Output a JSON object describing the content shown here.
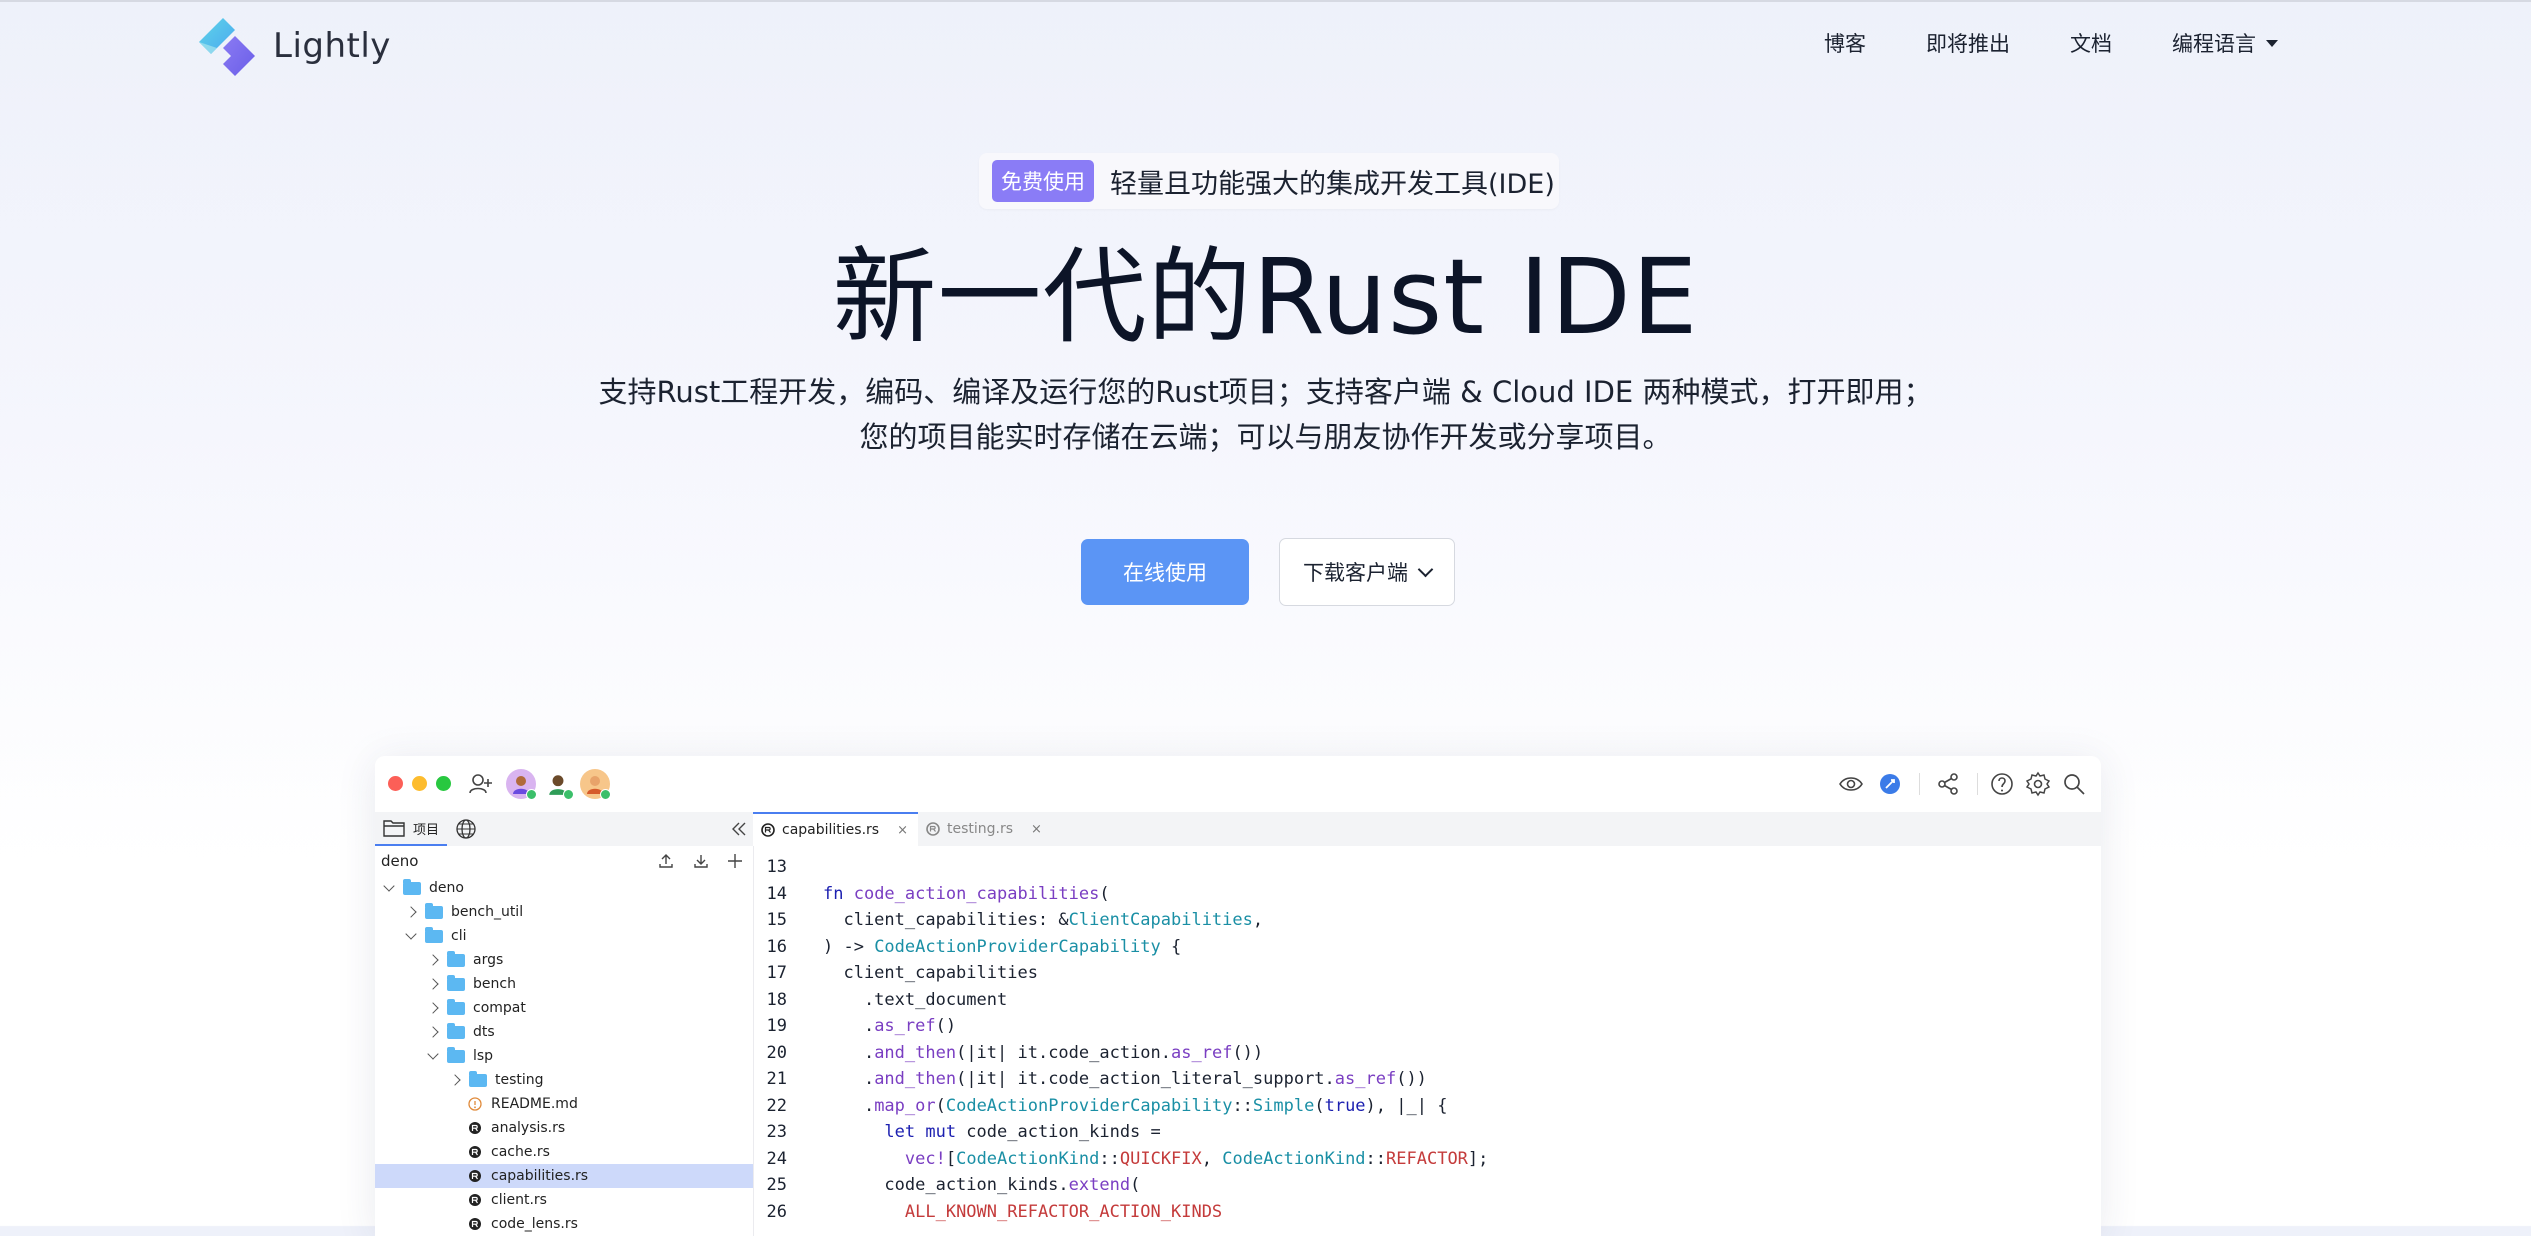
{
  "nav": {
    "brand": "Lightly",
    "items": [
      "博客",
      "即将推出",
      "文档"
    ],
    "lang_menu": "编程语言"
  },
  "hero": {
    "badge_pill": "免费使用",
    "badge_text": "轻量且功能强大的集成开发工具(IDE)",
    "title": "新一代的Rust IDE",
    "subtitle_line1": "支持Rust工程开发，编码、编译及运行您的Rust项目；支持客户端 & Cloud IDE 两种模式，打开即用；",
    "subtitle_line2": "您的项目能实时存储在云端；可以与朋友协作开发或分享项目。",
    "primary_button": "在线使用",
    "secondary_button": "下载客户端"
  },
  "ide": {
    "sidebar_tab_label": "项目",
    "project_name": "deno",
    "tree": [
      {
        "label": "deno",
        "type": "folder",
        "depth": 0,
        "expanded": true
      },
      {
        "label": "bench_util",
        "type": "folder",
        "depth": 1,
        "expanded": false
      },
      {
        "label": "cli",
        "type": "folder",
        "depth": 1,
        "expanded": true
      },
      {
        "label": "args",
        "type": "folder",
        "depth": 2,
        "expanded": false
      },
      {
        "label": "bench",
        "type": "folder",
        "depth": 2,
        "expanded": false
      },
      {
        "label": "compat",
        "type": "folder",
        "depth": 2,
        "expanded": false
      },
      {
        "label": "dts",
        "type": "folder",
        "depth": 2,
        "expanded": false
      },
      {
        "label": "lsp",
        "type": "folder",
        "depth": 2,
        "expanded": true
      },
      {
        "label": "testing",
        "type": "folder",
        "depth": 3,
        "expanded": false
      },
      {
        "label": "README.md",
        "type": "md",
        "depth": 3
      },
      {
        "label": "analysis.rs",
        "type": "rs",
        "depth": 3
      },
      {
        "label": "cache.rs",
        "type": "rs",
        "depth": 3
      },
      {
        "label": "capabilities.rs",
        "type": "rs",
        "depth": 3,
        "selected": true
      },
      {
        "label": "client.rs",
        "type": "rs",
        "depth": 3
      },
      {
        "label": "code_lens.rs",
        "type": "rs",
        "depth": 3
      }
    ],
    "tabs": [
      {
        "label": "capabilities.rs",
        "active": true
      },
      {
        "label": "testing.rs",
        "active": false
      }
    ],
    "tab_close": "×",
    "code": [
      {
        "n": "13",
        "tokens": []
      },
      {
        "n": "14",
        "tokens": [
          [
            "kw",
            "fn "
          ],
          [
            "fn",
            "code_action_capabilities"
          ],
          [
            "pu",
            "("
          ]
        ]
      },
      {
        "n": "15",
        "tokens": [
          [
            "pu",
            "  client_capabilities: &"
          ],
          [
            "ty",
            "ClientCapabilities"
          ],
          [
            "pu",
            ","
          ]
        ]
      },
      {
        "n": "16",
        "tokens": [
          [
            "pu",
            ") -> "
          ],
          [
            "ty",
            "CodeActionProviderCapability"
          ],
          [
            "pu",
            " {"
          ]
        ]
      },
      {
        "n": "17",
        "tokens": [
          [
            "pu",
            "  client_capabilities"
          ]
        ]
      },
      {
        "n": "18",
        "tokens": [
          [
            "pu",
            "    .text_document"
          ]
        ]
      },
      {
        "n": "19",
        "tokens": [
          [
            "pu",
            "    ."
          ],
          [
            "fn",
            "as_ref"
          ],
          [
            "pu",
            "()"
          ]
        ]
      },
      {
        "n": "20",
        "tokens": [
          [
            "pu",
            "    ."
          ],
          [
            "fn",
            "and_then"
          ],
          [
            "pu",
            "(|it| it.code_action."
          ],
          [
            "fn",
            "as_ref"
          ],
          [
            "pu",
            "())"
          ]
        ]
      },
      {
        "n": "21",
        "tokens": [
          [
            "pu",
            "    ."
          ],
          [
            "fn",
            "and_then"
          ],
          [
            "pu",
            "(|it| it.code_action_literal_support."
          ],
          [
            "fn",
            "as_ref"
          ],
          [
            "pu",
            "())"
          ]
        ]
      },
      {
        "n": "22",
        "tokens": [
          [
            "pu",
            "    ."
          ],
          [
            "fn",
            "map_or"
          ],
          [
            "pu",
            "("
          ],
          [
            "ty",
            "CodeActionProviderCapability"
          ],
          [
            "pu",
            "::"
          ],
          [
            "ty",
            "Simple"
          ],
          [
            "pu",
            "("
          ],
          [
            "kw",
            "true"
          ],
          [
            "pu",
            "), |_| {"
          ]
        ]
      },
      {
        "n": "23",
        "tokens": [
          [
            "kw",
            "      let mut "
          ],
          [
            "pu",
            "code_action_kinds ="
          ]
        ]
      },
      {
        "n": "24",
        "tokens": [
          [
            "pu",
            "        "
          ],
          [
            "fn",
            "vec!"
          ],
          [
            "pu",
            "["
          ],
          [
            "ty",
            "CodeActionKind"
          ],
          [
            "pu",
            "::"
          ],
          [
            "cn",
            "QUICKFIX"
          ],
          [
            "pu",
            ", "
          ],
          [
            "ty",
            "CodeActionKind"
          ],
          [
            "pu",
            "::"
          ],
          [
            "cn",
            "REFACTOR"
          ],
          [
            "pu",
            "];"
          ]
        ]
      },
      {
        "n": "25",
        "tokens": [
          [
            "pu",
            "      code_action_kinds."
          ],
          [
            "fn",
            "extend"
          ],
          [
            "pu",
            "("
          ]
        ]
      },
      {
        "n": "26",
        "tokens": [
          [
            "pu",
            "        "
          ],
          [
            "cn",
            "ALL_KNOWN_REFACTOR_ACTION_KINDS"
          ]
        ]
      }
    ]
  },
  "colors": {
    "accent": "#5b95f5",
    "pill": "#8a7cf6",
    "traffic_red": "#fc5f57",
    "traffic_yellow": "#fdbc2e",
    "traffic_green": "#28c840",
    "selection": "#cdd9fa"
  }
}
